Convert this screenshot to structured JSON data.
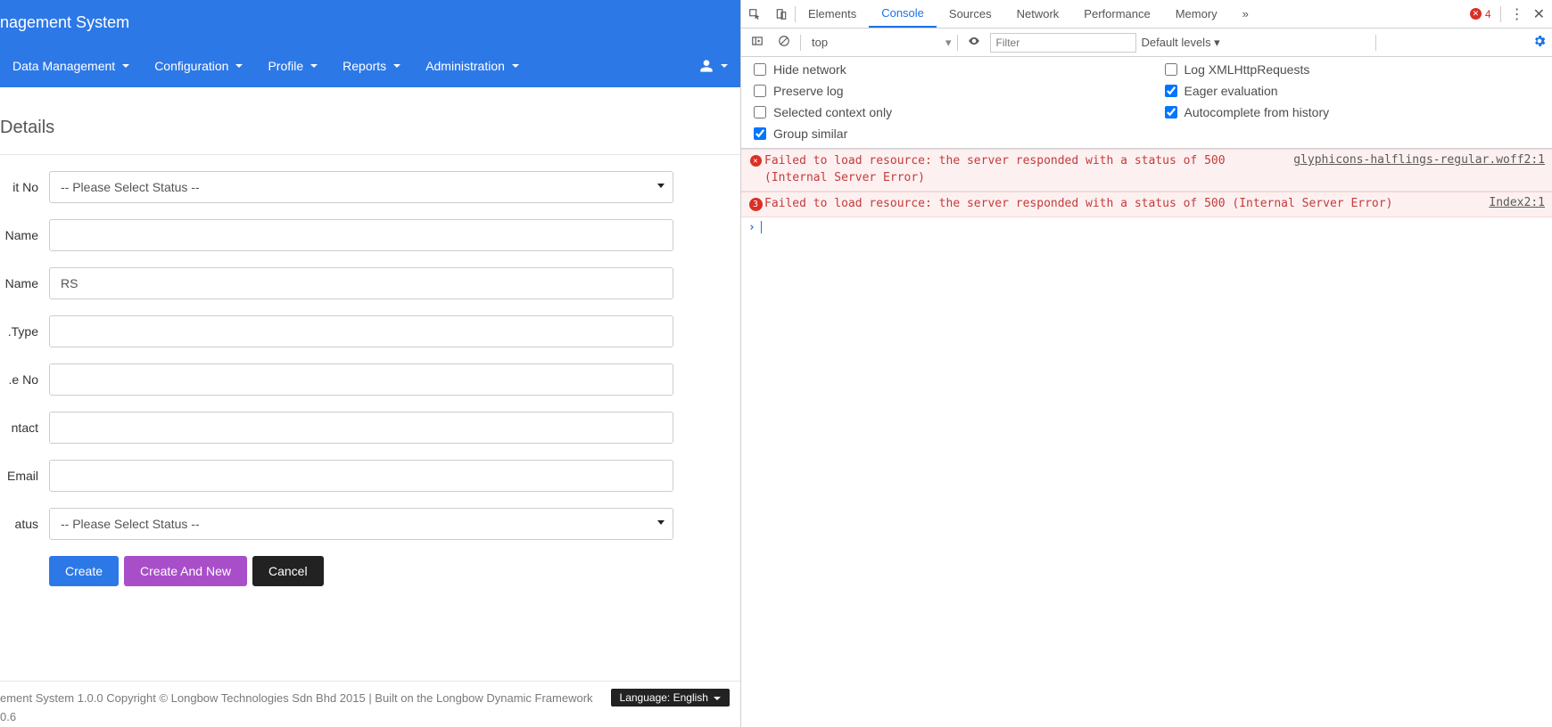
{
  "app": {
    "title": "nagement System",
    "nav": [
      "Data Management",
      "Configuration",
      "Profile",
      "Reports",
      "Administration"
    ]
  },
  "form": {
    "section_title": "Details",
    "labels": {
      "unit_no": "it No",
      "name": "Name",
      "short_name": "Name",
      "license_type": "Type.",
      "license_no": "e No.",
      "contact": "ntact",
      "email": "Email",
      "status": "atus"
    },
    "values": {
      "unit_no_select": "-- Please Select Status --",
      "name": "",
      "short_name": "RS",
      "license_type": "",
      "license_no": "",
      "contact": "",
      "email": "",
      "status_select": "-- Please Select Status --"
    },
    "buttons": {
      "create": "Create",
      "create_and_new": "Create And New",
      "cancel": "Cancel"
    }
  },
  "footer": {
    "line1": "ement System 1.0.0 Copyright © Longbow Technologies Sdn Bhd 2015 | Built on the Longbow Dynamic Framework",
    "line2": "0.6",
    "lang_label": "Language: English"
  },
  "devtools": {
    "tabs": [
      "Elements",
      "Console",
      "Sources",
      "Network",
      "Performance",
      "Memory"
    ],
    "active_tab": "Console",
    "error_count": "4",
    "toolbar": {
      "context": "top",
      "filter_placeholder": "Filter",
      "levels": "Default levels ▾"
    },
    "options": {
      "hide_network": {
        "label": "Hide network",
        "checked": false
      },
      "log_xhr": {
        "label": "Log XMLHttpRequests",
        "checked": false
      },
      "preserve_log": {
        "label": "Preserve log",
        "checked": false
      },
      "eager_eval": {
        "label": "Eager evaluation",
        "checked": true
      },
      "selected_ctx": {
        "label": "Selected context only",
        "checked": false
      },
      "autocomplete": {
        "label": "Autocomplete from history",
        "checked": true
      },
      "group_similar": {
        "label": "Group similar",
        "checked": true
      }
    },
    "console": [
      {
        "icon": "x",
        "msg": "Failed to load resource: the server responded with a status of 500 (Internal Server Error)",
        "src": "glyphicons-halflings-regular.woff2:1"
      },
      {
        "icon": "3",
        "msg": "Failed to load resource: the server responded with a status of 500 (Internal Server Error)",
        "src": "Index2:1"
      }
    ]
  }
}
